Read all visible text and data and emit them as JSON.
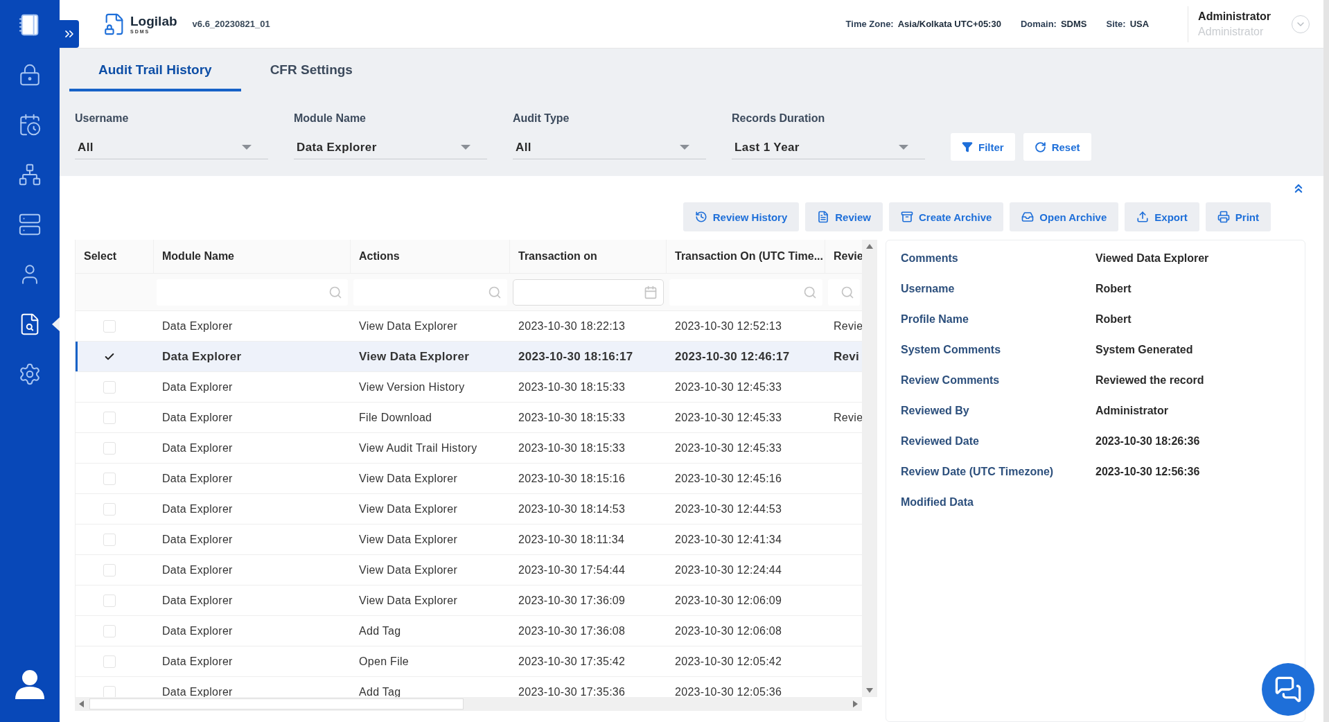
{
  "sidebar": {
    "items": [
      {
        "kind": "book",
        "selected": false
      },
      {
        "kind": "lock",
        "selected": false
      },
      {
        "kind": "calendar",
        "selected": false
      },
      {
        "kind": "network",
        "selected": false
      },
      {
        "kind": "server",
        "selected": false
      },
      {
        "kind": "user",
        "selected": false
      },
      {
        "kind": "audit",
        "selected": true
      },
      {
        "kind": "settings",
        "selected": false
      }
    ]
  },
  "header": {
    "logo": {
      "name": "Logilab",
      "sub": "SDMS"
    },
    "version": "v6.6_20230821_01",
    "info": [
      {
        "label": "Time Zone:",
        "value": "Asia/Kolkata UTC+05:30"
      },
      {
        "label": "Domain:",
        "value": "SDMS"
      },
      {
        "label": "Site:",
        "value": "USA"
      }
    ],
    "user": {
      "name": "Administrator",
      "role": "Administrator"
    }
  },
  "tabs": [
    {
      "label": "Audit Trail History",
      "selected": true
    },
    {
      "label": "CFR Settings",
      "selected": false
    }
  ],
  "filters": [
    {
      "label": "Username",
      "value": "All"
    },
    {
      "label": "Module Name",
      "value": "Data Explorer"
    },
    {
      "label": "Audit Type",
      "value": "All"
    },
    {
      "label": "Records Duration",
      "value": "Last 1 Year"
    }
  ],
  "filter_buttons": [
    {
      "label": "Filter",
      "kind": "filter"
    },
    {
      "label": "Reset",
      "kind": "reset"
    }
  ],
  "toolbar": [
    {
      "label": "Review History",
      "kind": "history"
    },
    {
      "label": "Review",
      "kind": "review"
    },
    {
      "label": "Create Archive",
      "kind": "archive"
    },
    {
      "label": "Open Archive",
      "kind": "open"
    },
    {
      "label": "Export",
      "kind": "export"
    },
    {
      "label": "Print",
      "kind": "print"
    }
  ],
  "table": {
    "select_header": "Select",
    "columns": [
      {
        "label": "Module Name",
        "kind": "search"
      },
      {
        "label": "Actions",
        "kind": "search"
      },
      {
        "label": "Transaction on",
        "kind": "date"
      },
      {
        "label": "Transaction On (UTC Time...",
        "kind": "search"
      },
      {
        "label": "Revie",
        "kind": "search"
      }
    ],
    "rows": [
      {
        "checked": false,
        "selected": false,
        "cells": [
          "Data Explorer",
          "View Data Explorer",
          "2023-10-30 18:22:13",
          "2023-10-30 12:52:13",
          "Revie"
        ]
      },
      {
        "checked": true,
        "selected": true,
        "cells": [
          "Data Explorer",
          "View Data Explorer",
          "2023-10-30 18:16:17",
          "2023-10-30 12:46:17",
          "Revi"
        ]
      },
      {
        "checked": false,
        "selected": false,
        "cells": [
          "Data Explorer",
          "View Version History",
          "2023-10-30 18:15:33",
          "2023-10-30 12:45:33"
        ]
      },
      {
        "checked": false,
        "selected": false,
        "cells": [
          "Data Explorer",
          "File Download",
          "2023-10-30 18:15:33",
          "2023-10-30 12:45:33",
          "Revie"
        ]
      },
      {
        "checked": false,
        "selected": false,
        "cells": [
          "Data Explorer",
          "View Audit Trail History",
          "2023-10-30 18:15:33",
          "2023-10-30 12:45:33"
        ]
      },
      {
        "checked": false,
        "selected": false,
        "cells": [
          "Data Explorer",
          "View Data Explorer",
          "2023-10-30 18:15:16",
          "2023-10-30 12:45:16"
        ]
      },
      {
        "checked": false,
        "selected": false,
        "cells": [
          "Data Explorer",
          "View Data Explorer",
          "2023-10-30 18:14:53",
          "2023-10-30 12:44:53"
        ]
      },
      {
        "checked": false,
        "selected": false,
        "cells": [
          "Data Explorer",
          "View Data Explorer",
          "2023-10-30 18:11:34",
          "2023-10-30 12:41:34"
        ]
      },
      {
        "checked": false,
        "selected": false,
        "cells": [
          "Data Explorer",
          "View Data Explorer",
          "2023-10-30 17:54:44",
          "2023-10-30 12:24:44"
        ]
      },
      {
        "checked": false,
        "selected": false,
        "cells": [
          "Data Explorer",
          "View Data Explorer",
          "2023-10-30 17:36:09",
          "2023-10-30 12:06:09"
        ]
      },
      {
        "checked": false,
        "selected": false,
        "cells": [
          "Data Explorer",
          "Add Tag",
          "2023-10-30 17:36:08",
          "2023-10-30 12:06:08"
        ]
      },
      {
        "checked": false,
        "selected": false,
        "cells": [
          "Data Explorer",
          "Open File",
          "2023-10-30 17:35:42",
          "2023-10-30 12:05:42"
        ]
      },
      {
        "checked": false,
        "selected": false,
        "cells": [
          "Data Explorer",
          "Add Tag",
          "2023-10-30 17:35:36",
          "2023-10-30 12:05:36"
        ]
      }
    ]
  },
  "details": [
    {
      "label": "Comments",
      "value": "Viewed Data Explorer"
    },
    {
      "label": "Username",
      "value": "Robert"
    },
    {
      "label": "Profile Name",
      "value": "Robert"
    },
    {
      "label": "System Comments",
      "value": "System Generated"
    },
    {
      "label": "Review Comments",
      "value": "Reviewed the record"
    },
    {
      "label": "Reviewed By",
      "value": "Administrator"
    },
    {
      "label": "Reviewed Date",
      "value": "2023-10-30 18:26:36"
    },
    {
      "label": "Review Date (UTC Timezone)",
      "value": "2023-10-30 12:56:36"
    },
    {
      "label": "Modified Data"
    }
  ]
}
